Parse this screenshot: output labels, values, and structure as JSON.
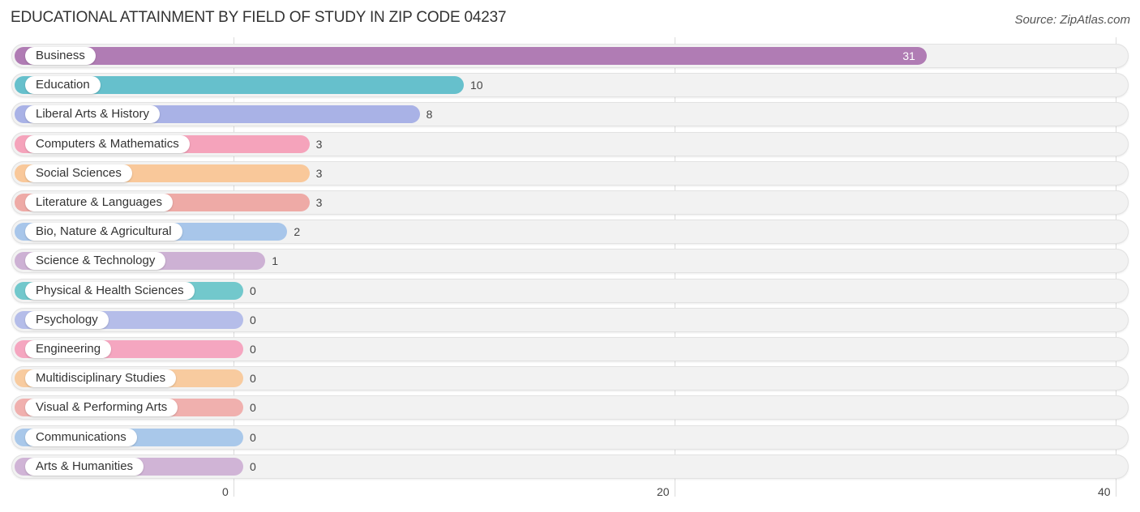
{
  "header": {
    "title": "EDUCATIONAL ATTAINMENT BY FIELD OF STUDY IN ZIP CODE 04237",
    "source": "Source: ZipAtlas.com"
  },
  "chart_data": {
    "type": "bar",
    "orientation": "horizontal",
    "title": "EDUCATIONAL ATTAINMENT BY FIELD OF STUDY IN ZIP CODE 04237",
    "xlabel": "",
    "ylabel": "",
    "xlim": [
      0,
      40
    ],
    "ticks": [
      0,
      20,
      40
    ],
    "tick_labels": [
      "0",
      "20",
      "40"
    ],
    "grid": true,
    "legend": "none",
    "categories": [
      "Business",
      "Education",
      "Liberal Arts & History",
      "Computers & Mathematics",
      "Social Sciences",
      "Literature & Languages",
      "Bio, Nature & Agricultural",
      "Science & Technology",
      "Physical & Health Sciences",
      "Psychology",
      "Engineering",
      "Multidisciplinary Studies",
      "Visual & Performing Arts",
      "Communications",
      "Arts & Humanities"
    ],
    "values": [
      31,
      10,
      8,
      3,
      3,
      3,
      2,
      1,
      0,
      0,
      0,
      0,
      0,
      0,
      0
    ],
    "colors": [
      "#b07cb4",
      "#66c0cc",
      "#a9b2e6",
      "#f5a3bb",
      "#f9c89a",
      "#eeaaa6",
      "#a8c6ea",
      "#cdb1d4",
      "#72c8cc",
      "#b5bde9",
      "#f5a6c0",
      "#f8cb9f",
      "#f0b0ae",
      "#a9c8ea",
      "#d0b4d6"
    ]
  }
}
